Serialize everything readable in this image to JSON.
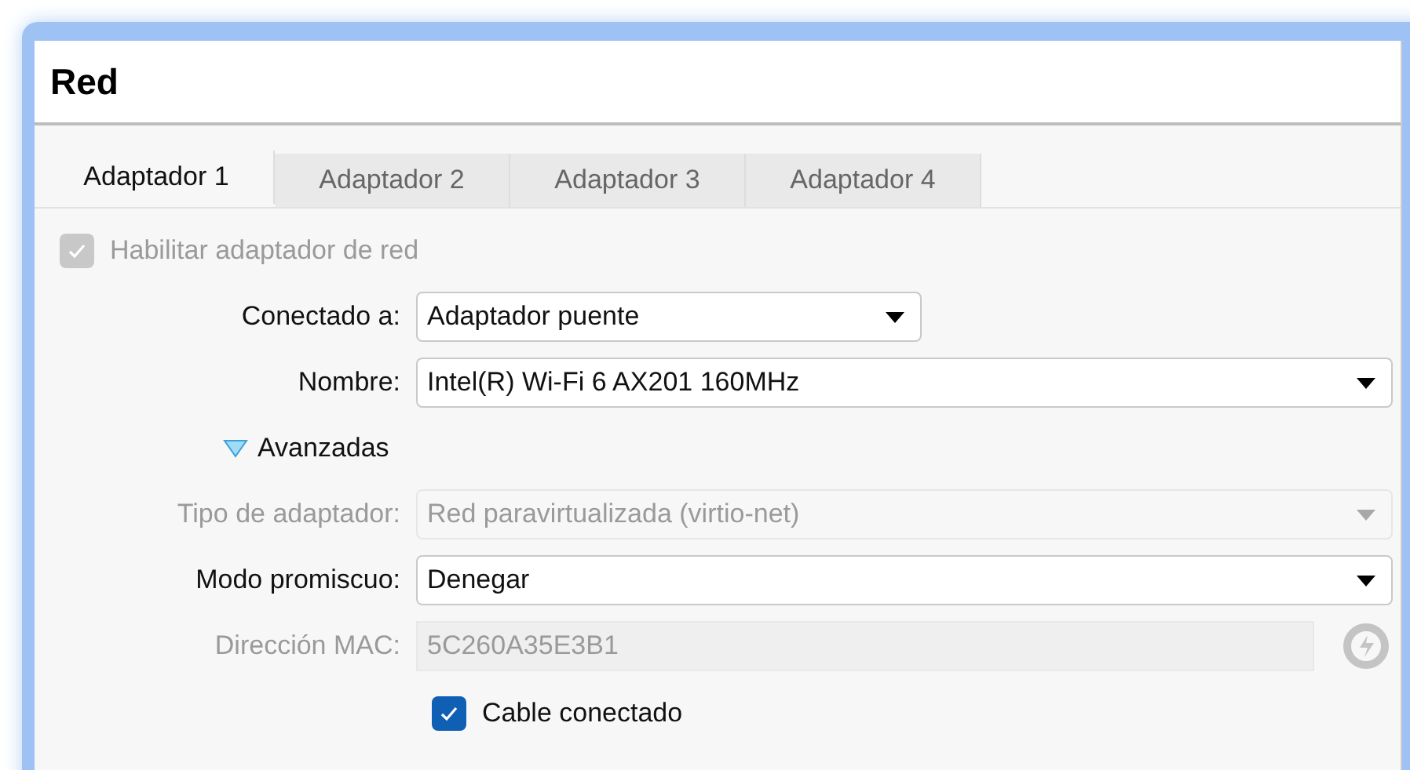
{
  "title": "Red",
  "tabs": [
    {
      "label": "Adaptador 1",
      "selected": true
    },
    {
      "label": "Adaptador 2",
      "selected": false
    },
    {
      "label": "Adaptador 3",
      "selected": false
    },
    {
      "label": "Adaptador 4",
      "selected": false
    }
  ],
  "enable": {
    "label": "Habilitar adaptador de red",
    "checked": true,
    "disabled": true
  },
  "rows": [
    {
      "kind": "select-short",
      "label": "Conectado a:",
      "value": "Adaptador puente",
      "disabled": false
    },
    {
      "kind": "select",
      "label": "Nombre:",
      "value": "Intel(R) Wi-Fi 6 AX201 160MHz",
      "disabled": false
    },
    {
      "kind": "expander",
      "label": "Avanzadas",
      "expanded": true
    },
    {
      "kind": "select",
      "label": "Tipo de adaptador:",
      "value": "Red paravirtualizada (virtio-net)",
      "disabled": true
    },
    {
      "kind": "select",
      "label": "Modo promiscuo:",
      "value": "Denegar",
      "disabled": false
    },
    {
      "kind": "mac",
      "label": "Dirección MAC:",
      "value": "5C260A35E3B1",
      "disabled": true
    },
    {
      "kind": "checkbox",
      "label": "Cable conectado",
      "checked": true
    }
  ]
}
